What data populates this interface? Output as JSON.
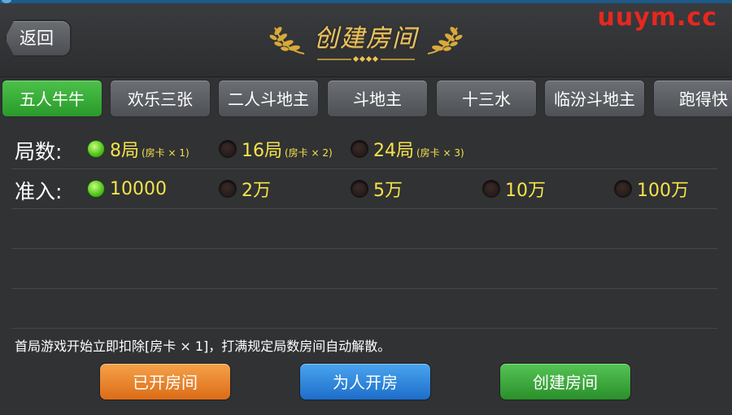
{
  "header": {
    "back_label": "返回",
    "title": "创建房间",
    "watermark": "uuym.cc"
  },
  "tabs": [
    {
      "label": "五人牛牛",
      "active": true
    },
    {
      "label": "欢乐三张",
      "active": false
    },
    {
      "label": "二人斗地主",
      "active": false
    },
    {
      "label": "斗地主",
      "active": false
    },
    {
      "label": "十三水",
      "active": false
    },
    {
      "label": "临汾斗地主",
      "active": false
    },
    {
      "label": "跑得快",
      "active": false
    }
  ],
  "rounds": {
    "label": "局数:",
    "options": [
      {
        "text": "8局",
        "cost": "(房卡 × 1)",
        "selected": true
      },
      {
        "text": "16局",
        "cost": "(房卡 × 2)",
        "selected": false
      },
      {
        "text": "24局",
        "cost": "(房卡 × 3)",
        "selected": false
      }
    ]
  },
  "entry": {
    "label": "准入:",
    "options": [
      {
        "text": "10000",
        "selected": true
      },
      {
        "text": "2万",
        "selected": false
      },
      {
        "text": "5万",
        "selected": false
      },
      {
        "text": "10万",
        "selected": false
      },
      {
        "text": "100万",
        "selected": false
      }
    ]
  },
  "notice": "首局游戏开始立即扣除[房卡 × 1]，打满规定局数房间自动解散。",
  "buttons": {
    "opened_rooms": "已开房间",
    "open_for_others": "为人开房",
    "create_room": "创建房间"
  },
  "colors": {
    "accent_green": "#3aaa36",
    "option_text": "#f6e24a",
    "title_gold": "#e8c267",
    "watermark_red": "#e8271e"
  }
}
